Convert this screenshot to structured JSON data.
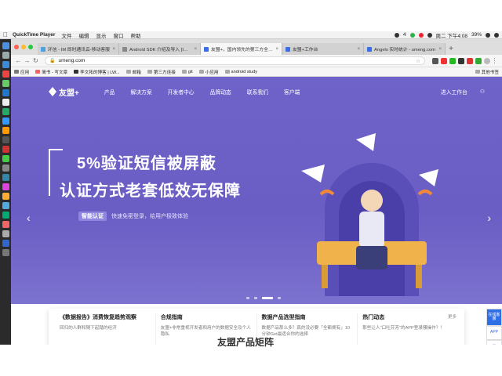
{
  "menubar": {
    "app_name": "QuickTime Player",
    "menus": [
      "文件",
      "编辑",
      "显示",
      "窗口",
      "帮助"
    ],
    "tray": {
      "num": "4",
      "datetime": "周二 下午4:08",
      "battery": "39%"
    }
  },
  "tabs": [
    {
      "label": "环信 - IM 即时通讯云-移动客服",
      "color": "#4aa3df"
    },
    {
      "label": "Android SDK 介绍及导入 [IM开",
      "color": "#888888"
    },
    {
      "label": "友盟+，国内领先的第三方全域数",
      "color": "#3a6ee8"
    },
    {
      "label": "友盟+工作台",
      "color": "#3a6ee8"
    },
    {
      "label": "Angels 实时统计 - umeng.com",
      "color": "#3a6ee8"
    }
  ],
  "address": {
    "url": "umeng.com"
  },
  "bookmarks": {
    "items": [
      "应用",
      "简书 - 写文章",
      "李文拓的博客 | LW...",
      "邮箱",
      "第三方连接",
      "git",
      "小应用",
      "android study"
    ],
    "other": "其他书签"
  },
  "site": {
    "logo": "友盟+",
    "nav": [
      "产品",
      "解决方案",
      "开发者中心",
      "品牌动态",
      "联系我们",
      "客户端"
    ],
    "workbench": "进入工作台"
  },
  "hero": {
    "line1": "5%验证短信被屏蔽",
    "line2": "认证方式老套低效无保障",
    "badge": "智能认证",
    "sub": "快速免密登录，给用户极致体验"
  },
  "cards": [
    {
      "title": "《数据报告》消费恢复趋势观察",
      "desc": "回归的人群和随下起踏的经济"
    },
    {
      "title": "合规指南",
      "desc": "友盟+非常重视开发者和用户的数据安全及个人隐私"
    },
    {
      "title": "数据产品选型指南",
      "desc": "数据产品那么多？真的没必要「全都拥有」10分钟Get最适合你的选择"
    },
    {
      "title": "热门动态",
      "desc": "那些让人\"口吐芬芳\"的APP登录骚操作？！"
    }
  ],
  "more": "更多",
  "section_title": "友盟产品矩阵",
  "float": {
    "online": "在线客服",
    "app": "APP"
  }
}
